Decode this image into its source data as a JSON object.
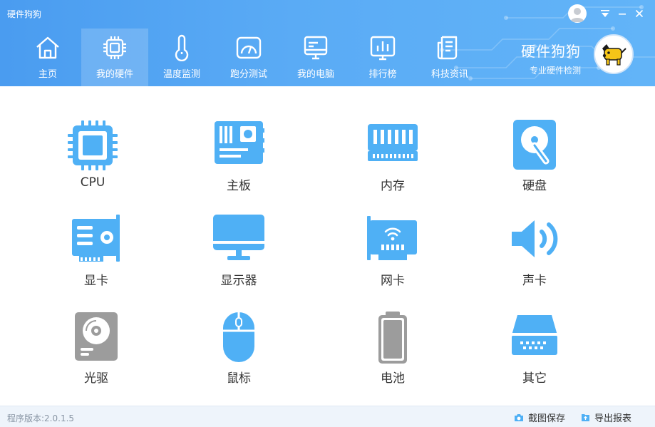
{
  "window": {
    "title": "硬件狗狗"
  },
  "nav": {
    "items": [
      {
        "label": "主页",
        "icon": "home-icon"
      },
      {
        "label": "我的硬件",
        "icon": "chip-icon",
        "active": true
      },
      {
        "label": "温度监测",
        "icon": "thermometer-icon"
      },
      {
        "label": "跑分测试",
        "icon": "gauge-icon"
      },
      {
        "label": "我的电脑",
        "icon": "monitor-icon"
      },
      {
        "label": "排行榜",
        "icon": "ranking-icon"
      },
      {
        "label": "科技资讯",
        "icon": "news-icon"
      }
    ]
  },
  "brand": {
    "name": "硬件狗狗",
    "subtitle": "专业硬件检测"
  },
  "hardware": {
    "items": [
      {
        "label": "CPU",
        "icon": "cpu-icon"
      },
      {
        "label": "主板",
        "icon": "motherboard-icon"
      },
      {
        "label": "内存",
        "icon": "memory-icon"
      },
      {
        "label": "硬盘",
        "icon": "hard-disk-icon"
      },
      {
        "label": "显卡",
        "icon": "graphics-card-icon"
      },
      {
        "label": "显示器",
        "icon": "display-icon"
      },
      {
        "label": "网卡",
        "icon": "network-card-icon"
      },
      {
        "label": "声卡",
        "icon": "speaker-icon"
      },
      {
        "label": "光驱",
        "icon": "optical-drive-icon"
      },
      {
        "label": "鼠标",
        "icon": "mouse-icon"
      },
      {
        "label": "电池",
        "icon": "battery-icon"
      },
      {
        "label": "其它",
        "icon": "other-device-icon"
      }
    ]
  },
  "footer": {
    "version": "程序版本:2.0.1.5",
    "screenshot_label": "截图保存",
    "export_label": "导出报表"
  },
  "colors": {
    "accent": "#4fb0f5",
    "header_start": "#4a9cf0",
    "header_end": "#62b4f8",
    "gray_icon": "#9c9c9c"
  }
}
